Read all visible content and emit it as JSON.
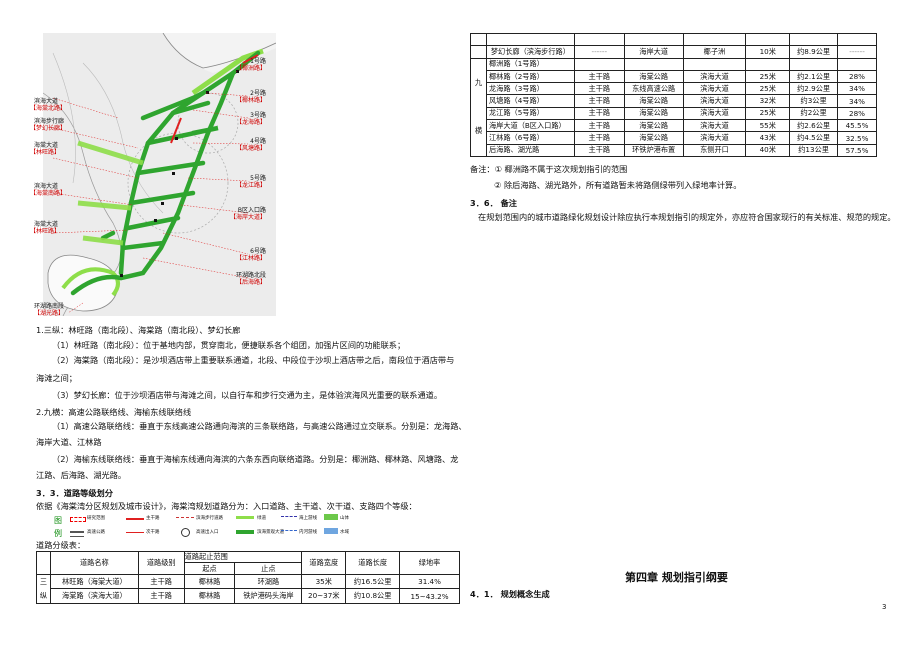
{
  "map": {
    "labels": [
      {
        "name": "1号路",
        "road": "【椰洲路】"
      },
      {
        "name": "2号路",
        "road": "【椰林路】"
      },
      {
        "name": "3号路",
        "road": "【龙海路】"
      },
      {
        "name": "4号路",
        "road": "【风塘路】"
      },
      {
        "name": "5号路",
        "road": "【龙江路】"
      },
      {
        "name": "B区入口路",
        "road": "【海岸大道】"
      },
      {
        "name": "6号路",
        "road": "【江林路】"
      },
      {
        "name": "环湖路北段",
        "road": "【后海路】"
      },
      {
        "name": "环湖路南段",
        "road": "【湖光路】"
      },
      {
        "name": "滨海大道",
        "road": "【海棠北路】"
      },
      {
        "name": "滨海步行廊",
        "road": "【梦幻长廊】"
      },
      {
        "name": "海棠大道",
        "road": "【林旺路】"
      },
      {
        "name": "滨海大道",
        "road": "【海棠南路】"
      },
      {
        "name": "海棠大道",
        "road": "【林旺路】"
      }
    ]
  },
  "left": {
    "p1_title": "1.三纵：林旺路（南北段）、海棠路（南北段）、梦幻长廊",
    "p1_a": "（1）林旺路（南北段）：位于基地内部，贯穿南北，便捷联系各个组团，加强片区间的功能联系；",
    "p1_b1": "（2）海棠路（南北段）：是沙坝酒店带上重要联系通道，北段、中段位于沙坝上酒店带之后，南段位于酒店带与",
    "p1_b2": "海滩之间；",
    "p1_c": "（3）梦幻长廊：位于沙坝酒店带与海滩之间，以自行车和步行交通为主，是体验滨海风光重要的联系通道。",
    "p2_title": "2.九横：高速公路联络线、海榆东线联络线",
    "p2_a1": "（1）高速公路联络线：垂直于东线高速公路通向海滨的三条联络路，与高速公路通过立交联系。分别是：龙海路、",
    "p2_a2": "海岸大道、江林路",
    "p2_b1": "（2）海榆东线联络线：垂直于海榆东线通向海滨的六条东西向联络道路。分别是：椰洲路、椰林路、风塘路、龙",
    "p2_b2": "江路、后海路、湖光路。",
    "sec33": "3．3．道路等级划分",
    "sec33_text": "依据《海棠湾分区规划及城市设计》，海棠湾规划道路分为：入口道路、主干道、次干道、支路四个等级：",
    "legend_tu": "图",
    "legend_li": "例",
    "legend_items": [
      "研究范围",
      "主干路",
      "滨海步行道路",
      "绿道",
      "海上游线",
      "山体",
      "高速公路",
      "次干路",
      "高速出入口",
      "滨海景观大道",
      "内河游线",
      "水域"
    ],
    "table_title": "道路分级表：",
    "table_head": [
      "道路名称",
      "道路级别",
      "道路起止范围",
      "道路宽度",
      "道路长度",
      "绿地率"
    ],
    "table_sub": [
      "起点",
      "止点"
    ],
    "table_group": [
      "三",
      "纵"
    ],
    "table_rows": [
      [
        "林旺路（海棠大道）",
        "主干路",
        "椰林路",
        "环湖路",
        "35米",
        "约16.5公里",
        "31.4%"
      ],
      [
        "海棠路（滨海大道）",
        "主干路",
        "椰林路",
        "铁炉港码头海岸",
        "20~37米",
        "约10.8公里",
        "15~43.2%"
      ]
    ]
  },
  "right": {
    "group": [
      "九",
      "横"
    ],
    "rows": [
      [
        "梦幻长廊（滨海步行路）",
        "------",
        "海岸大道",
        "椰子洲",
        "10米",
        "约8.9公里",
        "------"
      ],
      [
        "椰洲路（1号路）",
        "",
        "",
        "",
        "",
        "",
        ""
      ],
      [
        "椰林路（2号路）",
        "主干路",
        "海棠公路",
        "滨海大道",
        "25米",
        "约2.1公里",
        "28%"
      ],
      [
        "龙海路（3号路）",
        "主干路",
        "东线高速公路",
        "滨海大道",
        "25米",
        "约2.9公里",
        "34%"
      ],
      [
        "风塘路（4号路）",
        "主干路",
        "海棠公路",
        "滨海大道",
        "32米",
        "约3公里",
        "34%"
      ],
      [
        "龙江路（5号路）",
        "主干路",
        "海棠公路",
        "滨海大道",
        "25米",
        "约2公里",
        "28%"
      ],
      [
        "海岸大道（B区入口路）",
        "主干路",
        "海棠公路",
        "滨海大道",
        "55米",
        "约2.6公里",
        "45.5%"
      ],
      [
        "江林路（6号路）",
        "主干路",
        "海棠公路",
        "滨海大道",
        "43米",
        "约4.5公里",
        "32.5%"
      ],
      [
        "后海路、湖光路",
        "主干路",
        "环铁炉港布置",
        "东侧开口",
        "40米",
        "约13公里",
        "57.5%"
      ]
    ],
    "note1": "备注：①  椰洲路不属于这次规划指引的范围",
    "note2": "②  除后海路、湖光路外，所有道路暂未将路侧绿带列入绿地率计算。",
    "sec36": "3．6．  备注",
    "sec36_text": "在规划范围内的城市道路绿化规划设计除应执行本规划指引的规定外，亦应符合国家现行的有关标准、规范的规定。",
    "chapter": "第四章  规划指引纲要",
    "sec41": "4．1．  规划概念生成",
    "page_no": "3"
  },
  "colors": {
    "green": "#2fa52f",
    "lightgreen": "#8ede4a",
    "red": "#e02020",
    "label_red": "#d00000"
  }
}
